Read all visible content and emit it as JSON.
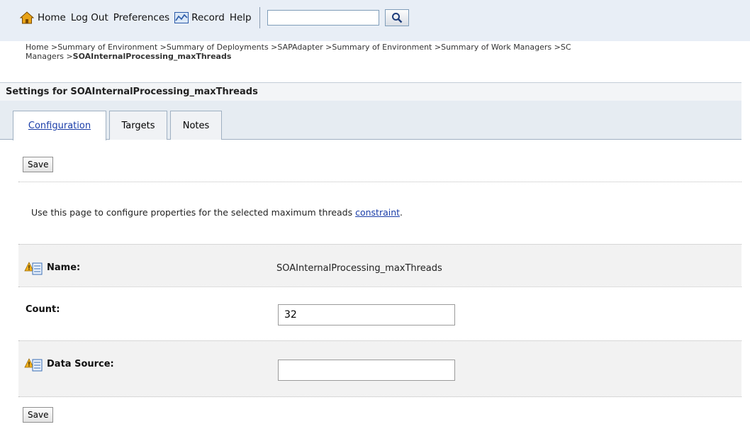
{
  "toolbar": {
    "home": "Home",
    "logout": "Log Out",
    "preferences": "Preferences",
    "record": "Record",
    "help": "Help",
    "search_value": ""
  },
  "breadcrumb": {
    "line1": "Home >Summary of Environment >Summary of Deployments >SAPAdapter >Summary of Environment >Summary of Work Managers >SC",
    "line2_prefix": "Managers >",
    "current": "SOAInternalProcessing_maxThreads"
  },
  "settings_title": "Settings for SOAInternalProcessing_maxThreads",
  "tabs": [
    {
      "label": "Configuration"
    },
    {
      "label": "Targets"
    },
    {
      "label": "Notes"
    }
  ],
  "save_label": "Save",
  "intro": {
    "text": "Use this page to configure properties for the selected maximum threads ",
    "link": "constraint",
    "end": "."
  },
  "fields": {
    "name_label": "Name:",
    "name_value": "SOAInternalProcessing_maxThreads",
    "count_label": "Count:",
    "count_value": "32",
    "datasource_label": "Data Source:",
    "datasource_value": ""
  }
}
